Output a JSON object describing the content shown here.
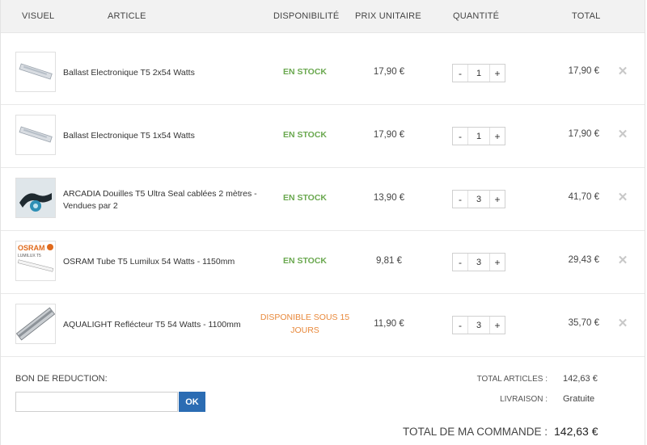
{
  "header": {
    "visuel": "VISUEL",
    "article": "ARTICLE",
    "disponibilite": "DISPONIBILITÉ",
    "prix_unitaire": "PRIX UNITAIRE",
    "quantite": "QUANTITÉ",
    "total": "TOTAL"
  },
  "items": [
    {
      "article": "Ballast Electronique T5 2x54 Watts",
      "dispo": "EN STOCK",
      "price": "17,90 €",
      "qty": "1",
      "total": "17,90 €",
      "thumb_icon": "ballast-image"
    },
    {
      "article": "Ballast Electronique T5 1x54 Watts",
      "dispo": "EN STOCK",
      "price": "17,90 €",
      "qty": "1",
      "total": "17,90 €",
      "thumb_icon": "ballast-image"
    },
    {
      "article": "ARCADIA Douilles T5 Ultra Seal cablées 2 mètres - Vendues par 2",
      "dispo": "EN STOCK",
      "price": "13,90 €",
      "qty": "3",
      "total": "41,70 €",
      "thumb_icon": "socket-image"
    },
    {
      "article": "OSRAM Tube T5 Lumilux 54 Watts - 1150mm",
      "dispo": "EN STOCK",
      "price": "9,81 €",
      "qty": "3",
      "total": "29,43 €",
      "thumb_icon": "osram-tube-image",
      "thumb_brand": "OSRAM",
      "thumb_sub": "LUMILUX T5"
    },
    {
      "article": "AQUALIGHT Reflécteur T5 54 Watts - 1100mm",
      "dispo": "DISPONIBLE SOUS 15 JOURS",
      "price": "11,90 €",
      "qty": "3",
      "total": "35,70 €",
      "thumb_icon": "reflector-image"
    }
  ],
  "qty_minus": "-",
  "qty_plus": "+",
  "remove_symbol": "✕",
  "coupon": {
    "label": "BON DE REDUCTION:",
    "placeholder": "",
    "button": "OK"
  },
  "summary": {
    "total_articles_label": "TOTAL ARTICLES :",
    "total_articles_value": "142,63 €",
    "livraison_label": "LIVRAISON :",
    "livraison_value": "Gratuite",
    "grand_total_label": "TOTAL DE MA COMMANDE :",
    "grand_total_value": "142,63 €"
  },
  "colors": {
    "in_stock": "#6aa84f",
    "delayed": "#e8883a",
    "ok_button": "#2b6cb3"
  }
}
